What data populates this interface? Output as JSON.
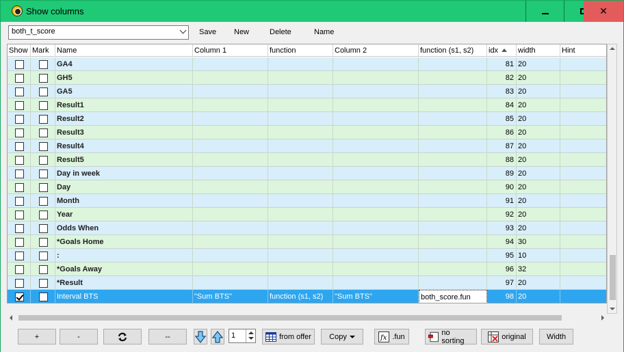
{
  "window": {
    "title": "Show columns",
    "accent": "#1fc976",
    "close_color": "#e35b5b",
    "minimize_glyph": "_",
    "maximize_glyph": "□",
    "close_glyph": "✕"
  },
  "toolbar": {
    "profile_value": "both_t_score",
    "save_label": "Save",
    "new_label": "New",
    "delete_label": "Delete",
    "name_label": "Name"
  },
  "grid": {
    "columns": [
      "Show",
      "Mark",
      "Name",
      "Column 1",
      "function",
      "Column 2",
      "function (s1, s2)",
      "idx",
      "width",
      "Hint"
    ],
    "sort_column": "idx",
    "sort_direction": "ascending",
    "rows": [
      {
        "show": false,
        "mark": false,
        "name": "GA4",
        "col1": "",
        "func": "",
        "col2": "",
        "func2": "",
        "idx": "81",
        "width": "20",
        "hint": "",
        "color": "blue"
      },
      {
        "show": false,
        "mark": false,
        "name": "GH5",
        "col1": "",
        "func": "",
        "col2": "",
        "func2": "",
        "idx": "82",
        "width": "20",
        "hint": "",
        "color": "green"
      },
      {
        "show": false,
        "mark": false,
        "name": "GA5",
        "col1": "",
        "func": "",
        "col2": "",
        "func2": "",
        "idx": "83",
        "width": "20",
        "hint": "",
        "color": "blue"
      },
      {
        "show": false,
        "mark": false,
        "name": "Result1",
        "col1": "",
        "func": "",
        "col2": "",
        "func2": "",
        "idx": "84",
        "width": "20",
        "hint": "",
        "color": "green"
      },
      {
        "show": false,
        "mark": false,
        "name": "Result2",
        "col1": "",
        "func": "",
        "col2": "",
        "func2": "",
        "idx": "85",
        "width": "20",
        "hint": "",
        "color": "blue"
      },
      {
        "show": false,
        "mark": false,
        "name": "Result3",
        "col1": "",
        "func": "",
        "col2": "",
        "func2": "",
        "idx": "86",
        "width": "20",
        "hint": "",
        "color": "green"
      },
      {
        "show": false,
        "mark": false,
        "name": "Result4",
        "col1": "",
        "func": "",
        "col2": "",
        "func2": "",
        "idx": "87",
        "width": "20",
        "hint": "",
        "color": "blue"
      },
      {
        "show": false,
        "mark": false,
        "name": "Result5",
        "col1": "",
        "func": "",
        "col2": "",
        "func2": "",
        "idx": "88",
        "width": "20",
        "hint": "",
        "color": "green"
      },
      {
        "show": false,
        "mark": false,
        "name": "Day in week",
        "col1": "",
        "func": "",
        "col2": "",
        "func2": "",
        "idx": "89",
        "width": "20",
        "hint": "",
        "color": "blue"
      },
      {
        "show": false,
        "mark": false,
        "name": "Day",
        "col1": "",
        "func": "",
        "col2": "",
        "func2": "",
        "idx": "90",
        "width": "20",
        "hint": "",
        "color": "green"
      },
      {
        "show": false,
        "mark": false,
        "name": "Month",
        "col1": "",
        "func": "",
        "col2": "",
        "func2": "",
        "idx": "91",
        "width": "20",
        "hint": "",
        "color": "blue"
      },
      {
        "show": false,
        "mark": false,
        "name": "Year",
        "col1": "",
        "func": "",
        "col2": "",
        "func2": "",
        "idx": "92",
        "width": "20",
        "hint": "",
        "color": "green"
      },
      {
        "show": false,
        "mark": false,
        "name": "Odds When",
        "col1": "",
        "func": "",
        "col2": "",
        "func2": "",
        "idx": "93",
        "width": "20",
        "hint": "",
        "color": "blue"
      },
      {
        "show": false,
        "mark": false,
        "name": "*Goals Home",
        "col1": "",
        "func": "",
        "col2": "",
        "func2": "",
        "idx": "94",
        "width": "30",
        "hint": "",
        "color": "green"
      },
      {
        "show": false,
        "mark": false,
        "name": ":",
        "col1": "",
        "func": "",
        "col2": "",
        "func2": "",
        "idx": "95",
        "width": "10",
        "hint": "",
        "color": "blue"
      },
      {
        "show": false,
        "mark": false,
        "name": "*Goals Away",
        "col1": "",
        "func": "",
        "col2": "",
        "func2": "",
        "idx": "96",
        "width": "32",
        "hint": "",
        "color": "green"
      },
      {
        "show": false,
        "mark": false,
        "name": "*Result",
        "col1": "",
        "func": "",
        "col2": "",
        "func2": "",
        "idx": "97",
        "width": "20",
        "hint": "",
        "color": "blue"
      },
      {
        "show": true,
        "mark": false,
        "name": "Interval BTS",
        "col1": "\"Sum BTS\"",
        "func": "function (s1, s2)",
        "col2": "\"Sum BTS\"",
        "func2": "both_score.fun",
        "idx": "98",
        "width": "20",
        "hint": "",
        "color": "sel"
      }
    ]
  },
  "bottom": {
    "add_label": "+",
    "remove_label": "-",
    "double_remove_label": "--",
    "step_value": "1",
    "from_offer_label": "from offer",
    "copy_label": "Copy",
    "fun_label": ".fun",
    "no_sorting_label": "no sorting",
    "original_label": "original",
    "width_label": "Width"
  }
}
